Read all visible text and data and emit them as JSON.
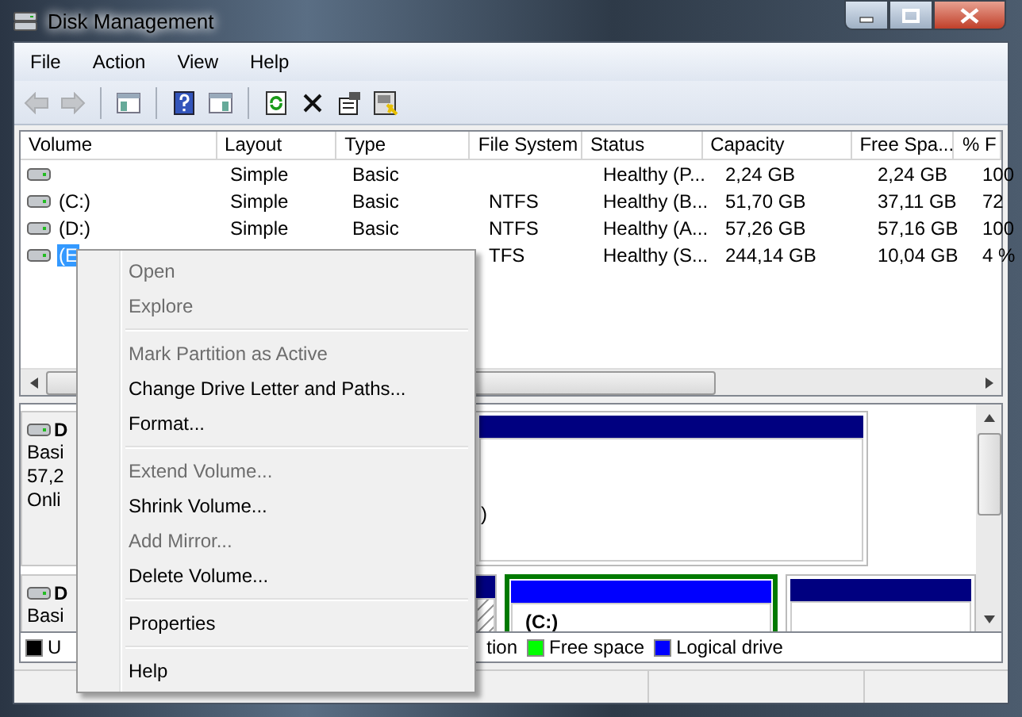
{
  "window": {
    "title": "Disk Management"
  },
  "menu_bar": [
    "File",
    "Action",
    "View",
    "Help"
  ],
  "toolbar": [
    [
      {
        "kind": "back",
        "disabled": true
      },
      {
        "kind": "forward",
        "disabled": true
      }
    ],
    [
      {
        "kind": "console-tree",
        "disabled": false
      }
    ],
    [
      {
        "kind": "help",
        "disabled": false
      },
      {
        "kind": "action-pane",
        "disabled": false
      }
    ],
    [
      {
        "kind": "refresh",
        "disabled": false
      },
      {
        "kind": "delete",
        "disabled": false
      },
      {
        "kind": "properties",
        "disabled": false
      },
      {
        "kind": "wizard",
        "disabled": false
      }
    ]
  ],
  "volume_table": {
    "columns": [
      "Volume",
      "Layout",
      "Type",
      "File System",
      "Status",
      "Capacity",
      "Free Spa...",
      "% F"
    ],
    "rows": [
      {
        "selected": false,
        "layout": "Simple",
        "type": "Basic",
        "status": "Healthy (P...",
        "capacity": "2,24 GB",
        "free_space": "2,24 GB",
        "percent_free": "100"
      },
      {
        "selected": false,
        "volume": "(C:)",
        "layout": "Simple",
        "type": "Basic",
        "file_system": "NTFS",
        "status": "Healthy (B...",
        "capacity": "51,70 GB",
        "free_space": "37,11 GB",
        "percent_free": "72"
      },
      {
        "selected": false,
        "volume": "(D:)",
        "layout": "Simple",
        "type": "Basic",
        "file_system": "NTFS",
        "status": "Healthy (A...",
        "capacity": "57,26 GB",
        "free_space": "57,16 GB",
        "percent_free": "100"
      },
      {
        "selected": true,
        "volume": "(E",
        "file_system": "TFS",
        "status": "Healthy (S...",
        "capacity": "244,14 GB",
        "free_space": "10,04 GB",
        "percent_free": "4 %"
      }
    ]
  },
  "disk_map": {
    "disks": [
      {
        "name": "D",
        "lines": [
          "Basi",
          "57,2",
          "Onli"
        ],
        "partitions": [
          {
            "kind": "primary",
            "text": ")"
          }
        ]
      },
      {
        "name": "D",
        "lines": [
          "Basi"
        ],
        "partitions": [
          {
            "kind": "hatched"
          },
          {
            "kind": "logical",
            "text": "(C:)"
          },
          {
            "kind": "primary"
          }
        ]
      }
    ],
    "legend": [
      {
        "label": "U",
        "color": "#000000"
      },
      {
        "label": "tion"
      },
      {
        "label": "Free space",
        "color": "#00ff00"
      },
      {
        "label": "Logical drive",
        "color": "#0000ff"
      }
    ]
  },
  "context_menu": [
    {
      "kind": "item",
      "label": "Open",
      "disabled": true
    },
    {
      "kind": "item",
      "label": "Explore",
      "disabled": true
    },
    {
      "kind": "separator"
    },
    {
      "kind": "item",
      "label": "Mark Partition as Active",
      "disabled": true
    },
    {
      "kind": "item",
      "label": "Change Drive Letter and Paths...",
      "disabled": false
    },
    {
      "kind": "item",
      "label": "Format...",
      "disabled": false
    },
    {
      "kind": "separator"
    },
    {
      "kind": "item",
      "label": "Extend Volume...",
      "disabled": true
    },
    {
      "kind": "item",
      "label": "Shrink Volume...",
      "disabled": false
    },
    {
      "kind": "item",
      "label": "Add Mirror...",
      "disabled": true
    },
    {
      "kind": "item",
      "label": "Delete Volume...",
      "disabled": false
    },
    {
      "kind": "separator"
    },
    {
      "kind": "item",
      "label": "Properties",
      "disabled": false
    },
    {
      "kind": "separator"
    },
    {
      "kind": "item",
      "label": "Help",
      "disabled": false
    }
  ]
}
